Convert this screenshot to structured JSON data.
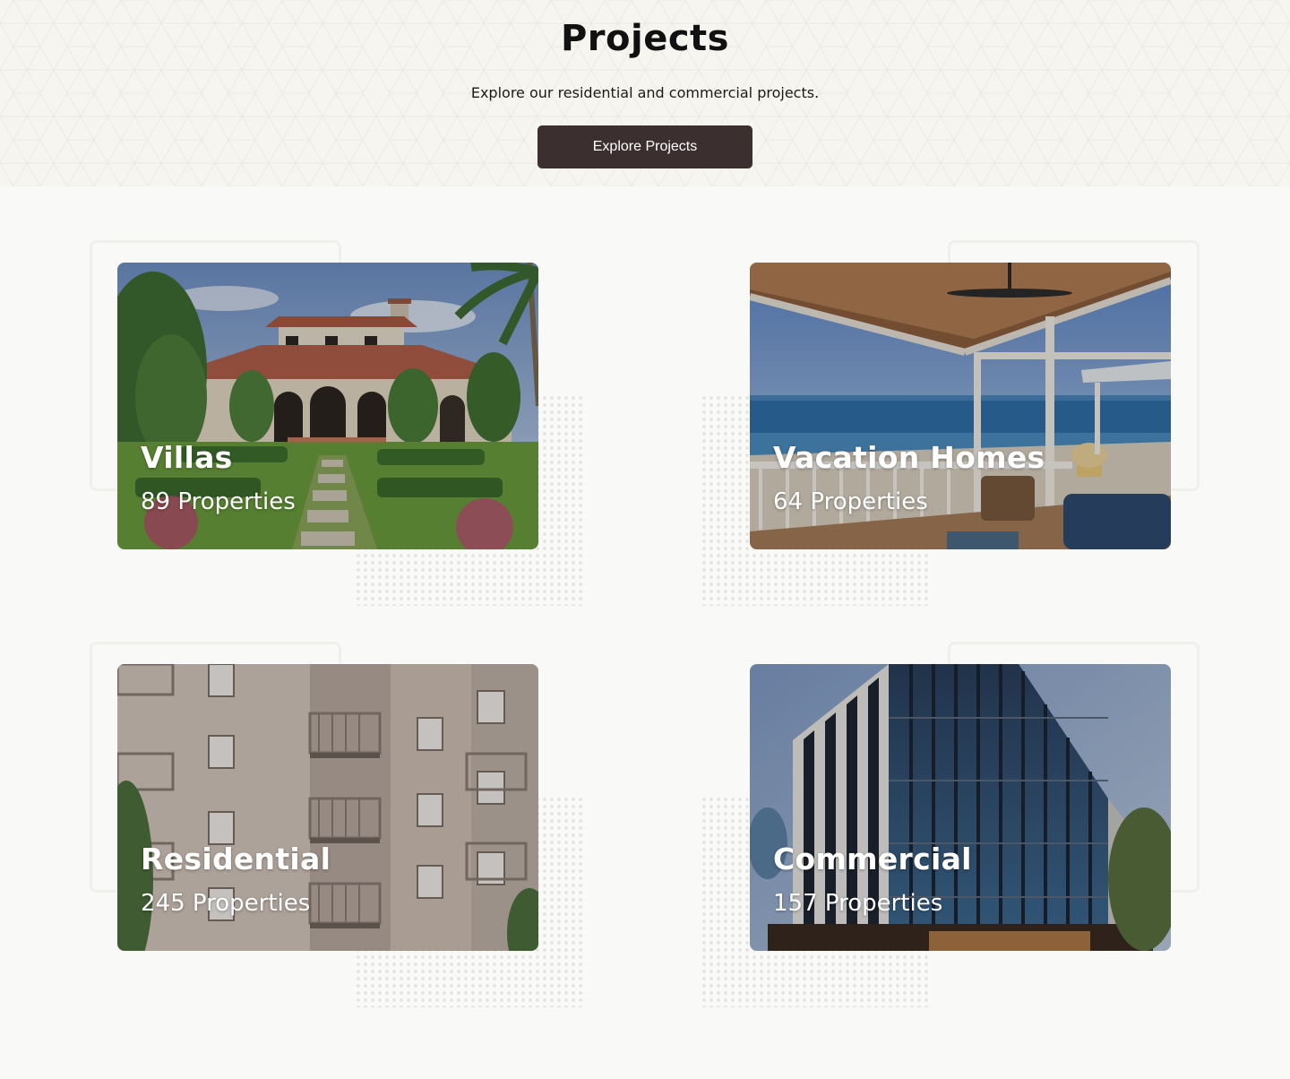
{
  "hero": {
    "title": "Projects",
    "subtitle": "Explore our residential and commercial projects.",
    "button_label": "Explore Projects",
    "button_color": "#3c2f30"
  },
  "categories": [
    {
      "title": "Villas",
      "count": "89 Properties",
      "image": "villa-photo"
    },
    {
      "title": "Vacation Homes",
      "count": "64 Properties",
      "image": "beach-balcony-photo"
    },
    {
      "title": "Residential",
      "count": "245 Properties",
      "image": "apartment-building-photo"
    },
    {
      "title": "Commercial",
      "count": "157 Properties",
      "image": "glass-office-building-photo"
    }
  ]
}
